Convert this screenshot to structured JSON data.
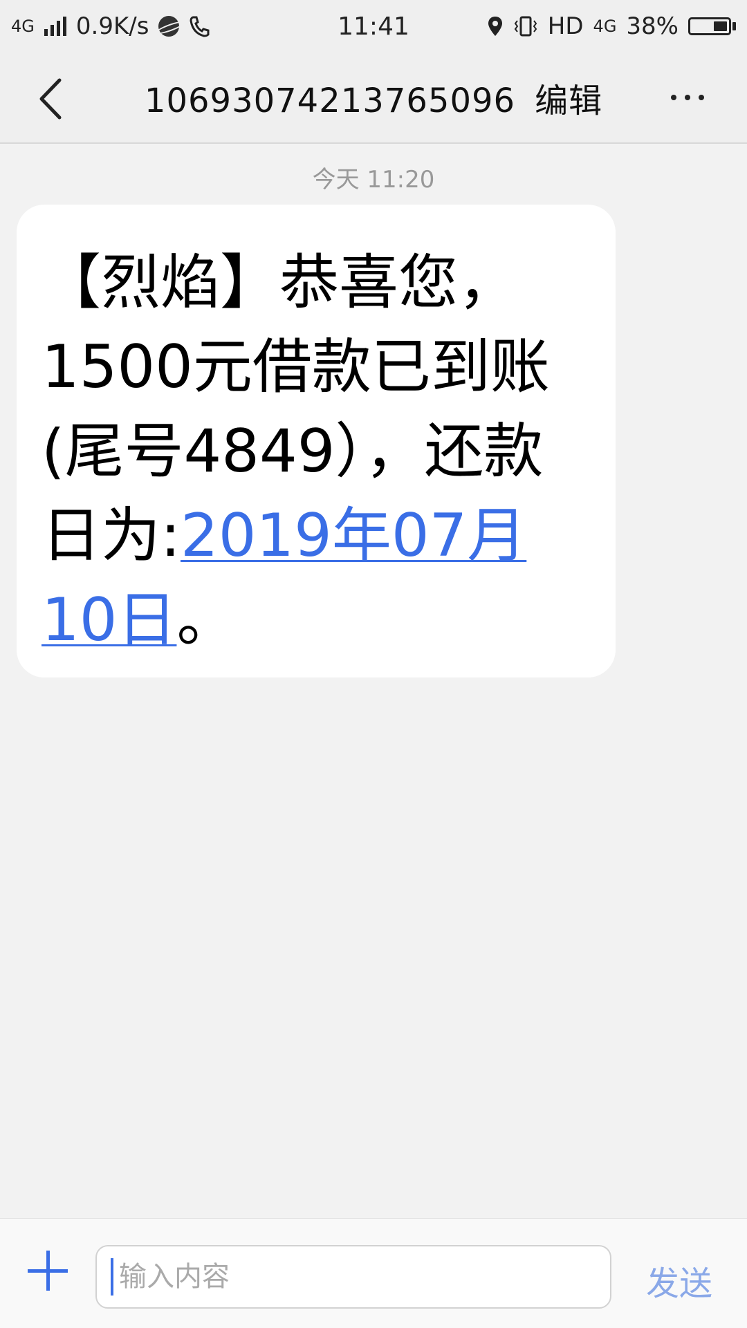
{
  "status_bar": {
    "network": "4G",
    "speed": "0.9K/s",
    "time": "11:41",
    "hd": "HD",
    "network2": "4G",
    "battery": "38%",
    "battery_level": 0.38
  },
  "header": {
    "title": "10693074213765096",
    "edit_label": "编辑"
  },
  "conversation": {
    "timestamp": "今天 11:20",
    "message": {
      "text_before_link": "【烈焰】恭喜您，1500元借款已到账(尾号4849），还款日为:",
      "link_text": "2019年07月10日",
      "text_after_link": "。"
    }
  },
  "composer": {
    "placeholder": "输入内容",
    "value": "",
    "send_label": "发送"
  },
  "colors": {
    "accent": "#3a6ee6",
    "send_disabled": "#8aa8e8",
    "background": "#f2f2f2"
  }
}
